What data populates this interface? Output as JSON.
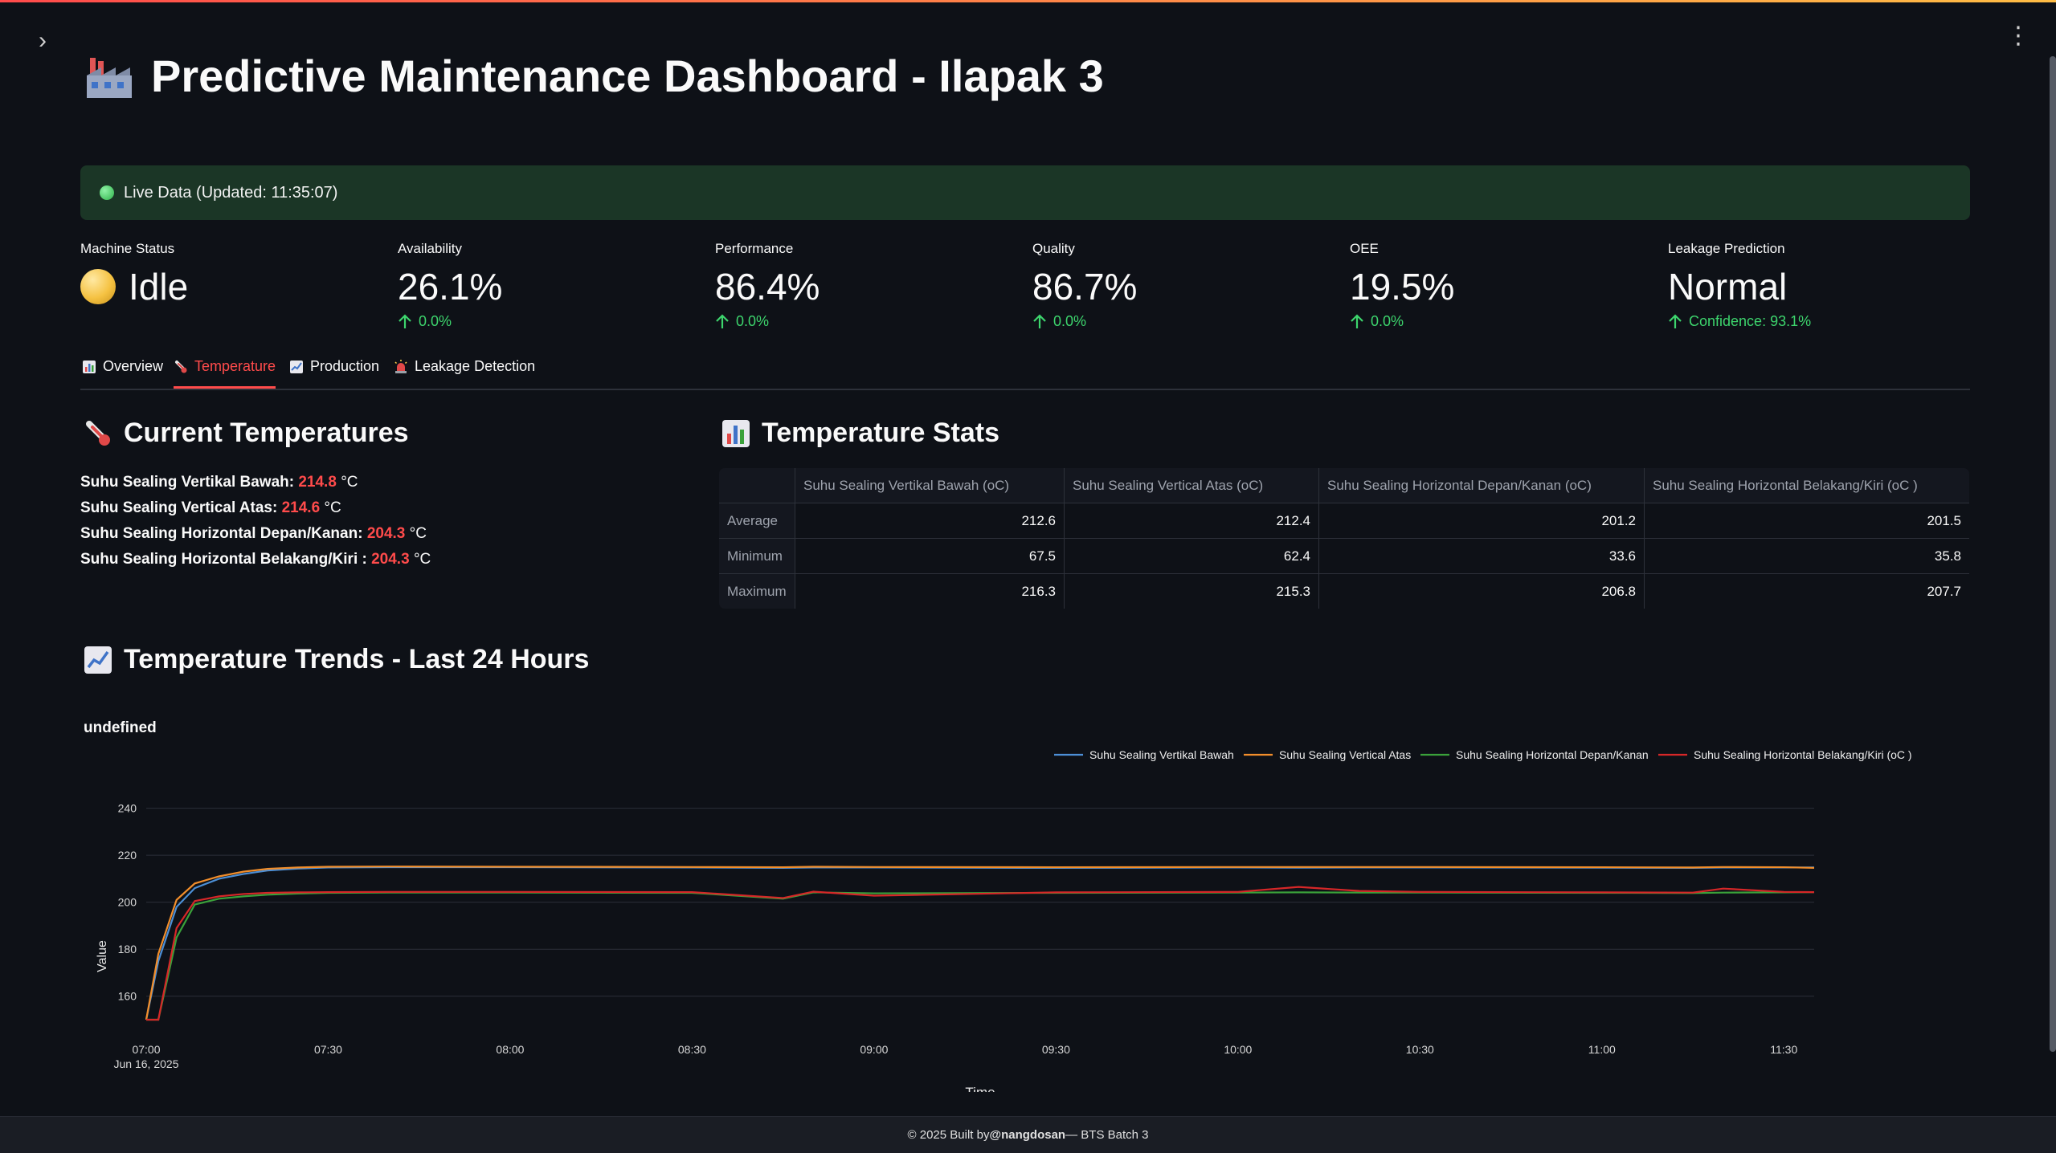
{
  "header": {
    "title": "Predictive Maintenance Dashboard - Ilapak 3",
    "title_icon": "factory-icon"
  },
  "live": {
    "text": "Live Data (Updated: 11:35:07)",
    "status_color": "#2fb34a"
  },
  "metrics": [
    {
      "label": "Machine Status",
      "value": "Idle",
      "delta": "",
      "icon": "status-dot-yellow"
    },
    {
      "label": "Availability",
      "value": "26.1%",
      "delta": "0.0%"
    },
    {
      "label": "Performance",
      "value": "86.4%",
      "delta": "0.0%"
    },
    {
      "label": "Quality",
      "value": "86.7%",
      "delta": "0.0%"
    },
    {
      "label": "OEE",
      "value": "19.5%",
      "delta": "0.0%"
    },
    {
      "label": "Leakage Prediction",
      "value": "Normal",
      "delta": "Confidence: 93.1%"
    }
  ],
  "tabs": [
    {
      "label": "Overview",
      "icon": "bar-chart-icon",
      "active": false
    },
    {
      "label": "Temperature",
      "icon": "thermometer-icon",
      "active": true
    },
    {
      "label": "Production",
      "icon": "line-chart-icon",
      "active": false
    },
    {
      "label": "Leakage Detection",
      "icon": "siren-icon",
      "active": false
    }
  ],
  "current_temps": {
    "heading": "Current Temperatures",
    "unit": "°C",
    "items": [
      {
        "label": "Suhu Sealing Vertikal Bawah:",
        "value": "214.8"
      },
      {
        "label": "Suhu Sealing Vertical Atas:",
        "value": "214.6"
      },
      {
        "label": "Suhu Sealing Horizontal Depan/Kanan:",
        "value": "204.3"
      },
      {
        "label": "Suhu Sealing Horizontal Belakang/Kiri :",
        "value": "204.3"
      }
    ]
  },
  "temp_stats": {
    "heading": "Temperature Stats",
    "columns": [
      "",
      "Suhu Sealing Vertikal Bawah (oC)",
      "Suhu Sealing Vertical Atas (oC)",
      "Suhu Sealing Horizontal Depan/Kanan (oC)",
      "Suhu Sealing Horizontal Belakang/Kiri (oC )"
    ],
    "rows": [
      [
        "Average",
        "212.6",
        "212.4",
        "201.2",
        "201.5"
      ],
      [
        "Minimum",
        "67.5",
        "62.4",
        "33.6",
        "35.8"
      ],
      [
        "Maximum",
        "216.3",
        "215.3",
        "206.8",
        "207.7"
      ]
    ]
  },
  "trends": {
    "heading": "Temperature Trends - Last 24 Hours"
  },
  "chart_data": {
    "type": "line",
    "title": "undefined",
    "xlabel": "Time",
    "ylabel": "Value",
    "ylim": [
      150,
      245
    ],
    "yticks": [
      160,
      180,
      200,
      220,
      240
    ],
    "xlim": [
      "07:00",
      "11:35"
    ],
    "xticks": [
      "07:00",
      "07:30",
      "08:00",
      "08:30",
      "09:00",
      "09:30",
      "10:00",
      "10:30",
      "11:00",
      "11:30"
    ],
    "x_date_label": "Jun 16, 2025",
    "grid": true,
    "legend_position": "top-right",
    "x": [
      "07:00",
      "07:02",
      "07:05",
      "07:08",
      "07:12",
      "07:16",
      "07:20",
      "07:25",
      "07:30",
      "07:40",
      "08:00",
      "08:30",
      "08:45",
      "08:50",
      "09:00",
      "09:30",
      "10:00",
      "10:10",
      "10:20",
      "10:30",
      "11:00",
      "11:15",
      "11:20",
      "11:30",
      "11:35"
    ],
    "series": [
      {
        "name": "Suhu Sealing Vertikal Bawah",
        "color": "#4c8fd6",
        "values": [
          150,
          175,
          198,
          206,
          210,
          212,
          213.5,
          214.3,
          214.8,
          214.9,
          214.9,
          214.8,
          214.6,
          214.8,
          214.8,
          214.6,
          214.8,
          214.7,
          214.8,
          214.8,
          214.7,
          214.6,
          214.8,
          214.8,
          214.8
        ]
      },
      {
        "name": "Suhu Sealing Vertical Atas",
        "color": "#f28e2b",
        "values": [
          150,
          178,
          201,
          208,
          211,
          213,
          214.2,
          214.8,
          215.1,
          215.2,
          215.1,
          215.0,
          214.9,
          215.1,
          215.0,
          214.9,
          215.0,
          215.0,
          215.0,
          215.0,
          214.9,
          214.8,
          215.0,
          214.9,
          214.6
        ]
      },
      {
        "name": "Suhu Sealing Horizontal Depan/Kanan",
        "color": "#3aa13a",
        "values": [
          150,
          150,
          185,
          199,
          201.5,
          202.5,
          203.2,
          203.7,
          204.0,
          204.1,
          204.1,
          204.0,
          201.5,
          204.2,
          203.8,
          204.0,
          204.1,
          204.2,
          204.1,
          204.1,
          204.0,
          203.9,
          204.1,
          204.2,
          204.3
        ]
      },
      {
        "name": "Suhu Sealing Horizontal Belakang/Kiri (oC )",
        "color": "#d62728",
        "values": [
          150,
          150,
          189,
          200.5,
          202.5,
          203.5,
          204.0,
          204.2,
          204.3,
          204.4,
          204.4,
          204.3,
          201.8,
          204.5,
          202.8,
          204.2,
          204.4,
          206.5,
          204.8,
          204.4,
          204.2,
          204.1,
          205.8,
          204.4,
          204.3
        ]
      }
    ]
  },
  "footer": {
    "prefix": "© 2025 Built by ",
    "author": "@nangdosan",
    "suffix": " — BTS Batch 3"
  }
}
